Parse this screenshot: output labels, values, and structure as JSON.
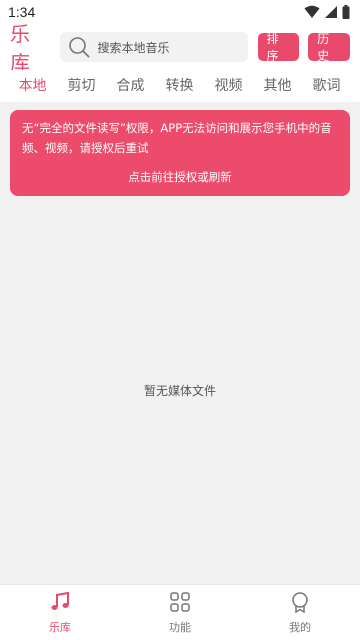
{
  "status_bar": {
    "time": "1:34"
  },
  "header": {
    "brand": "乐库",
    "search_placeholder": "搜索本地音乐",
    "sort_label": "排序",
    "history_label": "历史"
  },
  "tabs": [
    {
      "label": "本地",
      "active": true
    },
    {
      "label": "剪切",
      "active": false
    },
    {
      "label": "合成",
      "active": false
    },
    {
      "label": "转换",
      "active": false
    },
    {
      "label": "视频",
      "active": false
    },
    {
      "label": "其他",
      "active": false
    },
    {
      "label": "歌词",
      "active": false
    }
  ],
  "permission_banner": {
    "message": "无“完全的文件读写”权限，APP无法访问和展示您手机中的音频、视频，请授权后重试",
    "action": "点击前往授权或刷新"
  },
  "empty_state": "暂无媒体文件",
  "bottom_nav": [
    {
      "label": "乐库",
      "icon": "music-note-icon",
      "active": true
    },
    {
      "label": "功能",
      "icon": "grid-icon",
      "active": false
    },
    {
      "label": "我的",
      "icon": "profile-badge-icon",
      "active": false
    }
  ],
  "colors": {
    "accent": "#e84a6b",
    "banner": "#ec4b6c"
  }
}
